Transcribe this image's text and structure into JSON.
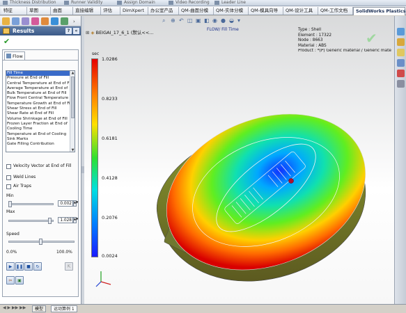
{
  "topbar": {
    "items": [
      "Thickness Distribution",
      "Runner Validity",
      "Assign Domain",
      "Video Recording",
      "Leader Line"
    ]
  },
  "tabs": [
    "特征",
    "草图",
    "曲面",
    "直接编辑",
    "评估",
    "DimXpert",
    "办公室产品",
    "QM-曲面分模",
    "QM-实体分模",
    "QM-模具向导",
    "QM-设计工具",
    "QM-工作文档",
    "SolidWorks Plastics"
  ],
  "panel": {
    "title": "Results",
    "help": "?",
    "collapse": "«",
    "ok": "✔",
    "flow_tab": "Flow",
    "results_list": [
      "Fill Time",
      "Pressure at End of Fill",
      "Central Temperature at End of F",
      "Average Temperature at End of",
      "Bulk Temperature at End of Fill",
      "Flow Front Central Temperature",
      "Temperature Growth at End of Fil",
      "Shear Stress at End of Fill",
      "Shear Rate at End of Fill",
      "Volume Shrinkage at End of Fill",
      "Frozen Layer Fraction at End of",
      "Cooling Time",
      "Temperature at End of Cooling",
      "Sink Marks",
      "Gate Filling Contribution"
    ],
    "selected_index": 0,
    "checkboxes": {
      "velocity_vector": "Velocity Vector at End of Fill",
      "weld_lines": "Weld Lines",
      "air_traps": "Air Traps"
    },
    "min_label": "Min",
    "min_value": "0.002",
    "max_label": "Max",
    "max_value": "1.028",
    "speed_label": "Speed",
    "speed_min": "0.0%",
    "speed_max": "100.0%"
  },
  "statusbar": {
    "tabs": [
      "模型",
      "运动算例 1"
    ]
  },
  "view": {
    "doc_title": "BEIGAI_17_6_1  (默认<<...",
    "result_title": "FLOW/ Fill Time",
    "info": [
      {
        "label": "Type",
        "value": "Shell"
      },
      {
        "label": "Element",
        "value": "17322"
      },
      {
        "label": "Node",
        "value": "8663"
      },
      {
        "label": "Material",
        "value": "ABS"
      },
      {
        "label": "Product",
        "value": "*(P)  Generic material / Generic mate"
      }
    ],
    "legend_unit": "sec",
    "legend_ticks": [
      "1.0286",
      "0.8233",
      "0.6181",
      "0.4128",
      "0.2076",
      "0.0024"
    ],
    "colors": {
      "accent": "#3b5a88",
      "legend_top": "#e60000",
      "legend_bottom": "#1a1aff"
    }
  }
}
